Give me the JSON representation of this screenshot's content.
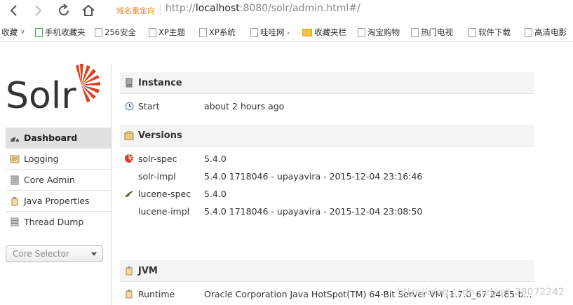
{
  "browser": {
    "url_tag": "域名重定向",
    "url_scheme": "http://",
    "url_host": "localhost",
    "url_rest": ":8080/solr/admin.html#/"
  },
  "bookmarks": {
    "favorites_label": "收藏",
    "items": [
      "手机收藏夹",
      "256安全",
      "XP主题",
      "XP系统",
      "哇哇网 -",
      "收藏夹栏",
      "淘宝购物",
      "热门电视",
      "软件下载",
      "高清电影"
    ]
  },
  "sidebar": {
    "logo_text": "Solr",
    "menu": [
      {
        "label": "Dashboard",
        "icon": "dashboard-icon",
        "active": true
      },
      {
        "label": "Logging",
        "icon": "logging-icon"
      },
      {
        "label": "Core Admin",
        "icon": "core-admin-icon"
      },
      {
        "label": "Java Properties",
        "icon": "java-properties-icon"
      },
      {
        "label": "Thread Dump",
        "icon": "thread-dump-icon"
      }
    ],
    "core_selector_placeholder": "Core Selector"
  },
  "instance": {
    "title": "Instance",
    "start_label": "Start",
    "start_value": "about 2 hours ago"
  },
  "versions": {
    "title": "Versions",
    "rows": [
      {
        "label": "solr-spec",
        "value": "5.4.0"
      },
      {
        "label": "solr-impl",
        "value": "5.4.0 1718046 - upayavira - 2015-12-04 23:16:46"
      },
      {
        "label": "lucene-spec",
        "value": "5.4.0"
      },
      {
        "label": "lucene-impl",
        "value": "5.4.0 1718046 - upayavira - 2015-12-04 23:08:50"
      }
    ]
  },
  "jvm": {
    "title": "JVM",
    "runtime_label": "Runtime",
    "runtime_value": "Oracle Corporation Java HotSpot(TM) 64-Bit Server VM (1.7.0_67 24.65-b..."
  },
  "watermark": "http://blog.csdn.net/qq_28072242",
  "colors": {
    "solr_orange": "#d9411e",
    "active_menu": "#e0e0e0",
    "section_header": "#f4f4f4",
    "url_tag": "#e8892c"
  }
}
